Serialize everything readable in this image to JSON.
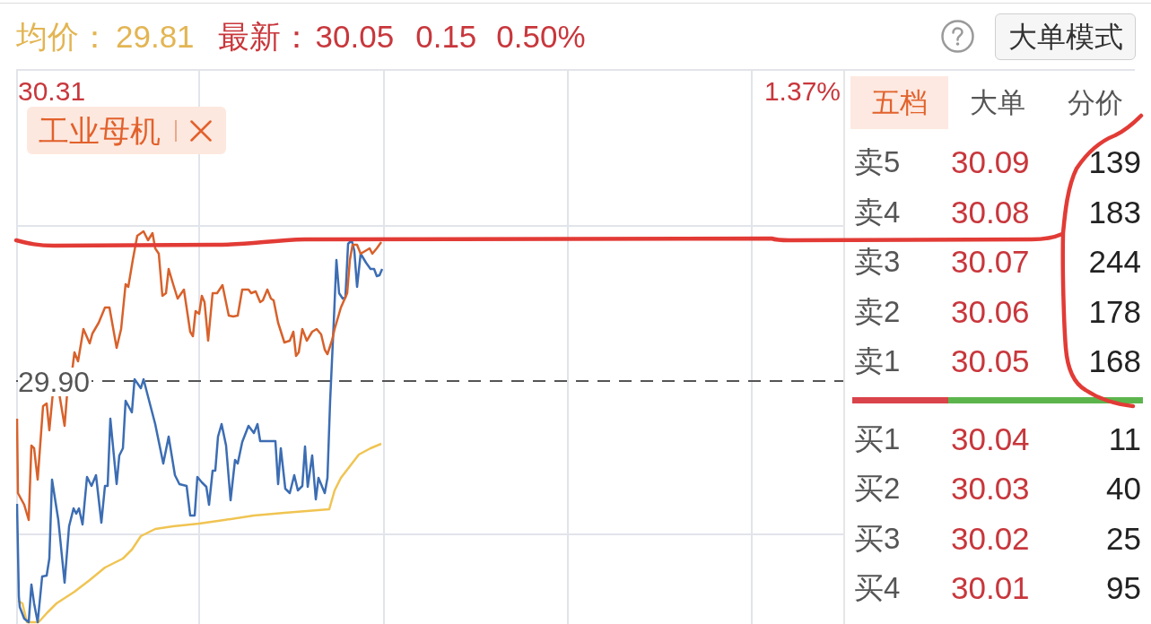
{
  "header": {
    "avg_label": "均价：",
    "avg_value": "29.81",
    "latest_label": "最新：",
    "latest_value": "30.05",
    "change": "0.15",
    "change_percent": "0.50%",
    "mode_button": "大单模式"
  },
  "chart": {
    "max_price": "30.31",
    "max_percent": "1.37%",
    "prev_close": "29.90",
    "tag": {
      "label": "工业母机"
    }
  },
  "order_book": {
    "tabs": [
      {
        "label": "五档",
        "selected": true
      },
      {
        "label": "大单",
        "selected": false
      },
      {
        "label": "分价",
        "selected": false
      }
    ],
    "asks": [
      {
        "label": "卖5",
        "price": "30.09",
        "volume": "139"
      },
      {
        "label": "卖4",
        "price": "30.08",
        "volume": "183"
      },
      {
        "label": "卖3",
        "price": "30.07",
        "volume": "244"
      },
      {
        "label": "卖2",
        "price": "30.06",
        "volume": "178"
      },
      {
        "label": "卖1",
        "price": "30.05",
        "volume": "168"
      }
    ],
    "balance_bar": {
      "level": 0.33
    },
    "bids": [
      {
        "label": "买1",
        "price": "30.04",
        "volume": "11"
      },
      {
        "label": "买2",
        "price": "30.03",
        "volume": "40"
      },
      {
        "label": "买3",
        "price": "30.02",
        "volume": "25"
      },
      {
        "label": "买4",
        "price": "30.01",
        "volume": "95"
      }
    ]
  }
}
